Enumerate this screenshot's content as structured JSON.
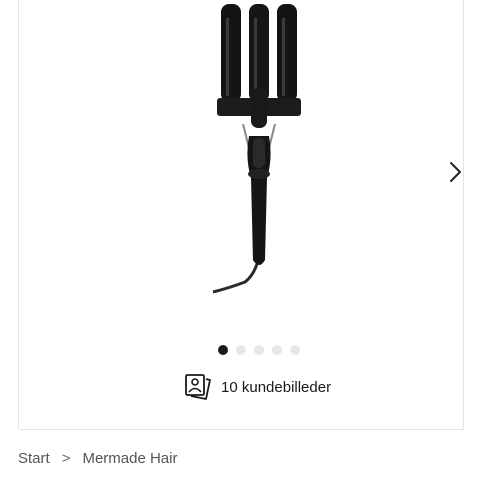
{
  "gallery": {
    "slide_count": 5,
    "active_slide": 1
  },
  "customer_photos": {
    "label": "10 kundebilleder",
    "icon": "customer-photos-icon"
  },
  "breadcrumb": {
    "items": [
      "Start",
      "Mermade Hair"
    ],
    "separator": ">"
  },
  "colors": {
    "active_dot": "#1a1a1a",
    "inactive_dot": "#e6e6e6",
    "border": "#e3e3e3"
  }
}
